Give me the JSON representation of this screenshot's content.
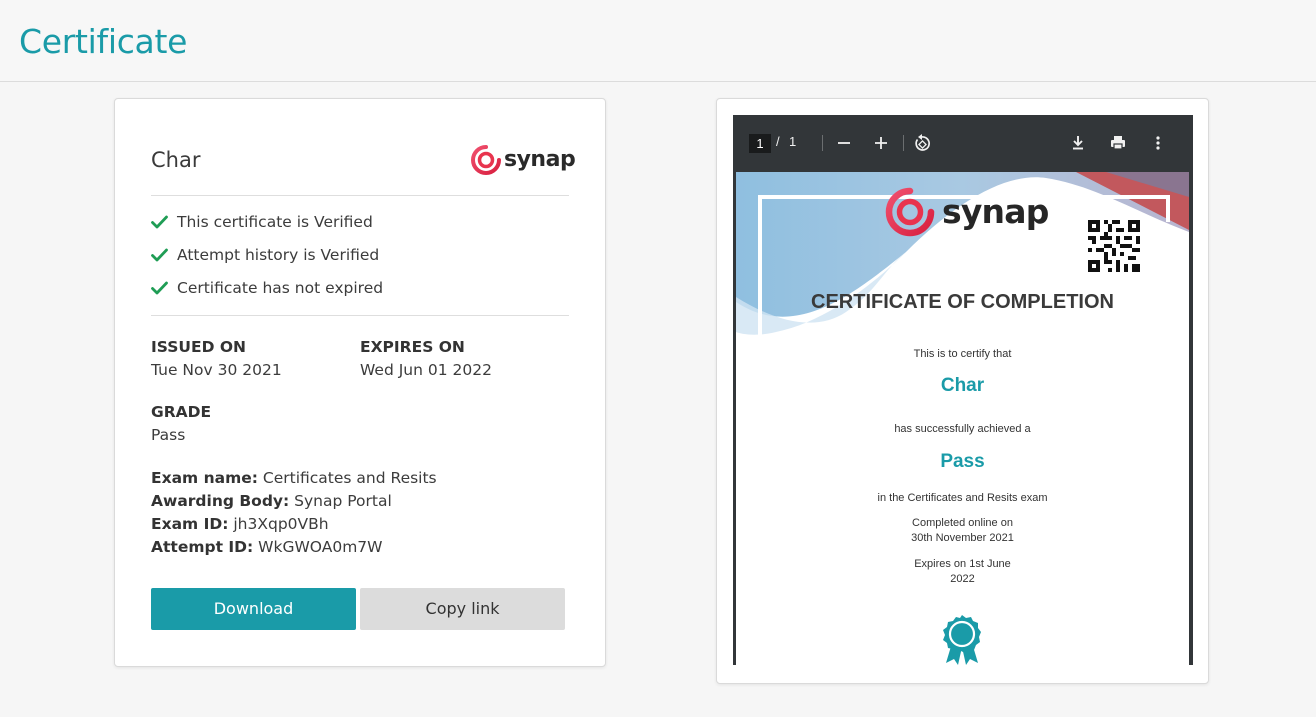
{
  "page": {
    "title": "Certificate"
  },
  "summary": {
    "name": "Char",
    "brand": "synap",
    "checks": [
      {
        "label": "This certificate is Verified"
      },
      {
        "label": "Attempt history is Verified"
      },
      {
        "label": "Certificate has not expired"
      }
    ],
    "issued_label": "ISSUED ON",
    "issued_value": "Tue Nov 30 2021",
    "expires_label": "EXPIRES ON",
    "expires_value": "Wed Jun 01 2022",
    "grade_label": "GRADE",
    "grade_value": "Pass",
    "exam_name_label": "Exam name:",
    "exam_name_value": "Certificates and Resits",
    "awarding_label": "Awarding Body:",
    "awarding_value": "Synap Portal",
    "exam_id_label": "Exam ID:",
    "exam_id_value": "jh3Xqp0VBh",
    "attempt_id_label": "Attempt ID:",
    "attempt_id_value": "WkGWOA0m7W",
    "download_label": "Download",
    "copy_link_label": "Copy link"
  },
  "viewer": {
    "current_page": "1",
    "separator": "/",
    "total_pages": "1",
    "certificate": {
      "brand": "synap",
      "heading": "CERTIFICATE OF COMPLETION",
      "certify_text": "This is to certify that",
      "recipient": "Char",
      "achieved_text": "has successfully achieved a",
      "grade": "Pass",
      "exam_text": "in the Certificates and Resits exam",
      "completed_line1": "Completed online on",
      "completed_line2": "30th November 2021",
      "expires_line1": "Expires on 1st June",
      "expires_line2": "2022"
    }
  },
  "colors": {
    "accent": "#1a9ba8",
    "check": "#1f9d55",
    "logo_red": "#e8344e"
  },
  "icons": {
    "check": "check-icon",
    "zoom_out": "zoom-out-icon",
    "zoom_in": "zoom-in-icon",
    "rotate": "rotate-icon",
    "download": "download-icon",
    "print": "print-icon",
    "more": "more-vert-icon"
  }
}
